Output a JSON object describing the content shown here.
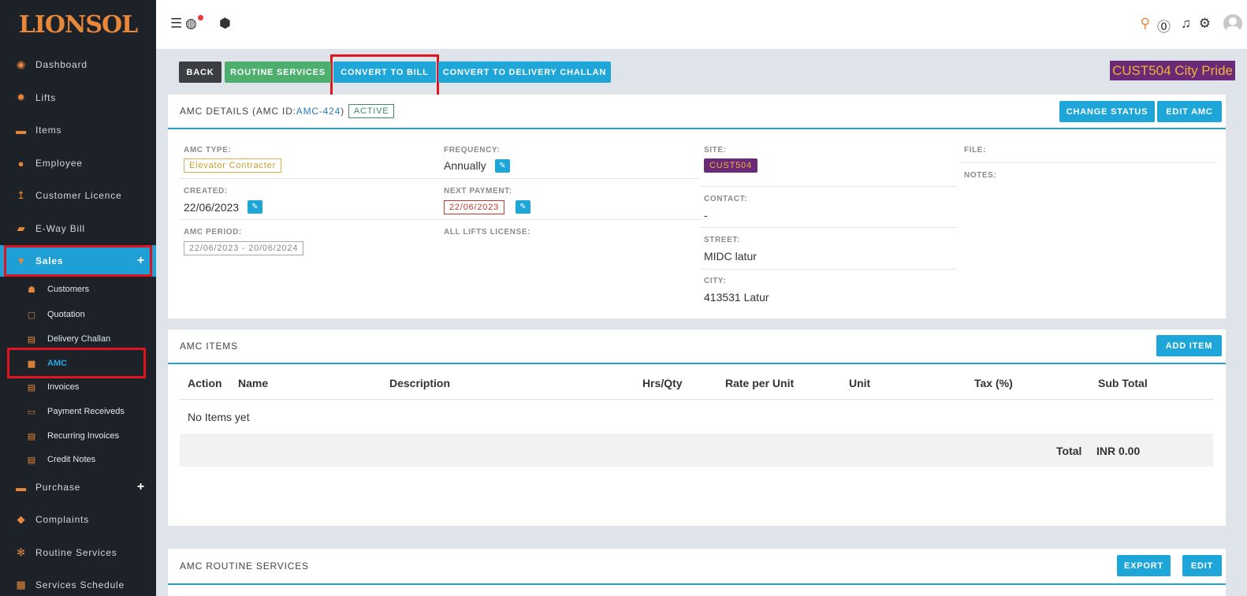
{
  "app": {
    "logo": "LIONSOL"
  },
  "sidebar": {
    "items": [
      {
        "label": "Dashboard",
        "icon": "dashboard-icon"
      },
      {
        "label": "Lifts",
        "icon": "gear-icon"
      },
      {
        "label": "Items",
        "icon": "box-icon"
      },
      {
        "label": "Employee",
        "icon": "user-icon"
      },
      {
        "label": "Customer Licence",
        "icon": "arrow-up-icon"
      },
      {
        "label": "E-Way Bill",
        "icon": "truck-icon"
      },
      {
        "label": "Sales",
        "icon": "cart-icon"
      },
      {
        "label": "Purchase",
        "icon": "briefcase-icon"
      },
      {
        "label": "Complaints",
        "icon": "tag-icon"
      },
      {
        "label": "Routine Services",
        "icon": "gears-icon"
      },
      {
        "label": "Services Schedule",
        "icon": "grid-icon"
      }
    ],
    "sub_items": [
      {
        "label": "Customers"
      },
      {
        "label": "Quotation"
      },
      {
        "label": "Delivery Challan"
      },
      {
        "label": "AMC"
      },
      {
        "label": "Invoices"
      },
      {
        "label": "Payment Receiveds"
      },
      {
        "label": "Recurring Invoices"
      },
      {
        "label": "Credit Notes"
      }
    ],
    "plus": "+"
  },
  "toolbar": {
    "back": "BACK",
    "routine_services": "ROUTINE SERVICES",
    "convert_to_bill": "CONVERT TO BILL",
    "convert_to_delivery_challan": "CONVERT TO DELIVERY CHALLAN",
    "customer_badge": "CUST504 City Pride"
  },
  "amc_details": {
    "title_prefix": "AMC DETAILS (AMC ID: ",
    "amc_id": "AMC-424",
    "title_suffix": ")",
    "status": "ACTIVE",
    "change_status": "CHANGE STATUS",
    "edit_amc": "EDIT AMC",
    "amc_type_label": "AMC TYPE:",
    "amc_type": "Elevator Contracter",
    "created_label": "CREATED:",
    "created": "22/06/2023",
    "amc_period_label": "AMC PERIOD:",
    "amc_period": "22/06/2023 - 20/06/2024",
    "frequency_label": "FREQUENCY:",
    "frequency": "Annually",
    "next_payment_label": "NEXT PAYMENT:",
    "next_payment": "22/06/2023",
    "all_lifts_label": "ALL LIFTS LICENSE:",
    "site_label": "SITE:",
    "site": "CUST504",
    "contact_label": "CONTACT:",
    "contact": "-",
    "street_label": "STREET:",
    "street": "MIDC latur",
    "city_label": "CITY:",
    "city": "413531 Latur",
    "file_label": "FILE:",
    "notes_label": "NOTES:"
  },
  "amc_items": {
    "title": "AMC ITEMS",
    "add_item": "ADD ITEM",
    "columns": [
      "Action",
      "Name",
      "Description",
      "Hrs/Qty",
      "Rate per Unit",
      "Unit",
      "Tax (%)",
      "Sub Total"
    ],
    "empty": "No Items yet",
    "total_label": "Total",
    "total_value": "INR 0.00"
  },
  "amc_routine": {
    "title": "AMC ROUTINE SERVICES",
    "export": "EXPORT",
    "edit": "EDIT"
  },
  "colors": {
    "accent": "#1ea6d9",
    "sidebar_bg": "#1d2228",
    "sidebar_icon": "#e8873a",
    "highlight_box": "#e0141e"
  }
}
